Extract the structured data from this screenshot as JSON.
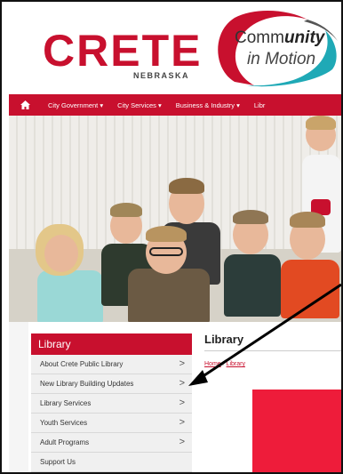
{
  "header": {
    "logo_name": "CRETE",
    "logo_state": "NEBRASKA",
    "tagline_line1_prefix": "Comm",
    "tagline_line1_bold": "unity",
    "tagline_line2": "in Motion"
  },
  "nav": {
    "home_icon": "home-icon",
    "items": [
      {
        "label": "City Government ▾"
      },
      {
        "label": "City Services ▾"
      },
      {
        "label": "Business & Industry ▾"
      },
      {
        "label": "Libr"
      }
    ]
  },
  "sidebar": {
    "title": "Library",
    "items": [
      {
        "label": "About Crete Public Library",
        "chevron": ">"
      },
      {
        "label": "New Library Building Updates",
        "chevron": ">"
      },
      {
        "label": "Library Services",
        "chevron": ">"
      },
      {
        "label": "Youth Services",
        "chevron": ">"
      },
      {
        "label": "Adult Programs",
        "chevron": ">"
      },
      {
        "label": "Support Us",
        "chevron": ""
      }
    ]
  },
  "main": {
    "title": "Library",
    "breadcrumb_home": "Home",
    "breadcrumb_sep": "/",
    "breadcrumb_current": "Library"
  },
  "colors": {
    "brand_red": "#c8102e",
    "banner_red": "#ee1c3a"
  }
}
